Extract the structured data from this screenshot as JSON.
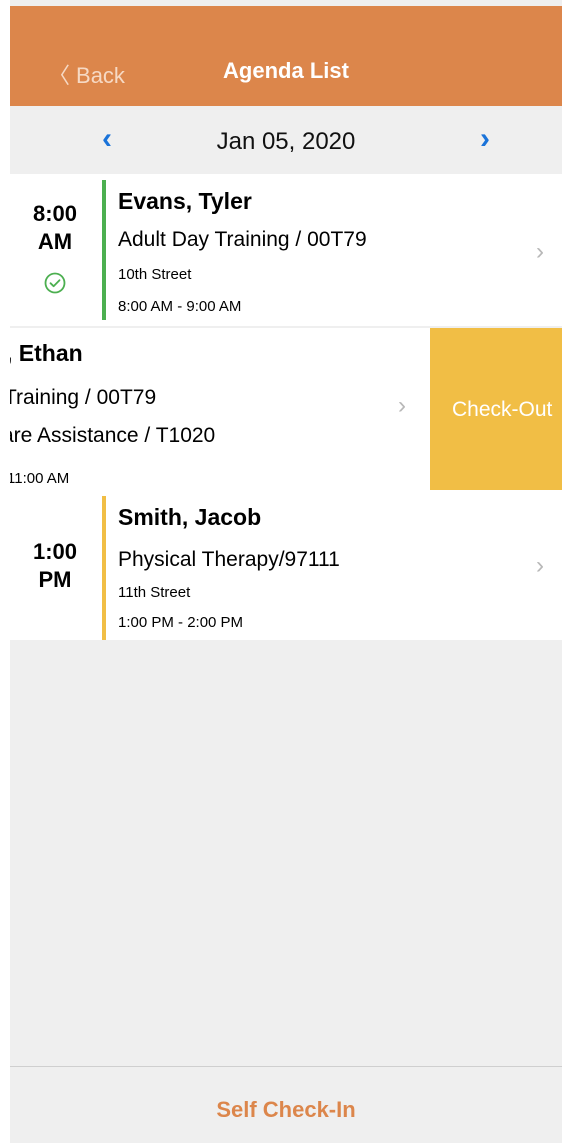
{
  "header": {
    "back_label": "Back",
    "title": "Agenda List"
  },
  "date_nav": {
    "date": "Jan 05, 2020",
    "prev_glyph": "‹",
    "next_glyph": "›"
  },
  "appointments": [
    {
      "time": "8:00",
      "ampm": "AM",
      "name": "Evans, Tyler",
      "service": "Adult Day Training / 00T79",
      "location": "10th Street",
      "range": "8:00 AM - 9:00 AM",
      "status_icon": "check-circle-icon",
      "status_color": "#4caf50"
    },
    {
      "name": ", Ethan",
      "service": "Training / 00T79",
      "service2": "are Assistance / T1020",
      "range": "11:00 AM",
      "action": "Check-Out",
      "action_color": "#f1be45"
    },
    {
      "time": "1:00",
      "ampm": "PM",
      "name": "Smith, Jacob",
      "service": "Physical Therapy/97111",
      "location": "11th Street",
      "range": "1:00 PM - 2:00 PM",
      "status_color": "#f1be45"
    }
  ],
  "footer": {
    "button_label": "Self Check-In"
  },
  "colors": {
    "brand": "#dc864b",
    "nav_arrow": "#1a73d9"
  }
}
